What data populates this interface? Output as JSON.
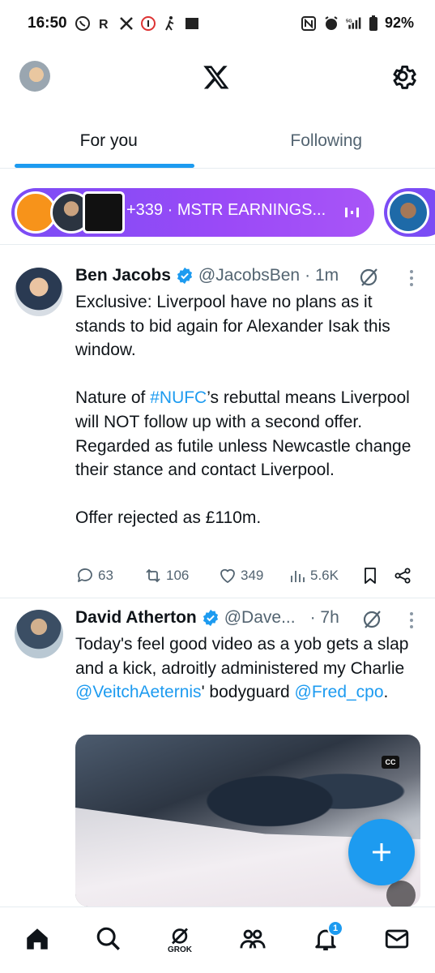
{
  "status_bar": {
    "time": "16:50",
    "battery": "92%",
    "network": "5G",
    "left_icons": [
      "whatsapp-icon",
      "r-icon",
      "x-icon",
      "counter-icon",
      "walk-icon",
      "app-icon"
    ],
    "right_icons": [
      "nfc-icon",
      "alarm-icon",
      "signal-icon",
      "battery-icon"
    ]
  },
  "header": {
    "logo": "x-logo-icon",
    "settings_icon": "gear-icon"
  },
  "tabs": {
    "for_you": "For you",
    "following": "Following",
    "active": "for_you"
  },
  "spaces": {
    "label": "+339 · MSTR EARNINGS...",
    "accent": "#8b4cf6"
  },
  "posts": [
    {
      "name": "Ben Jacobs",
      "handle": "@JacobsBen",
      "time": "· 1m",
      "verified": true,
      "text": "Exclusive: Liverpool have no plans as it stands to bid again for Alexander Isak this window.",
      "text2_pre": "Nature of ",
      "hashtag": "#NUFC",
      "text2_post": "’s rebuttal means Liverpool will NOT follow up with a second offer. Regarded as futile unless Newcastle change their stance and contact Liverpool.",
      "text3": "Offer rejected as £110m.",
      "replies": "63",
      "reposts": "106",
      "likes": "349",
      "views": "5.6K"
    },
    {
      "name": "David Atherton",
      "handle": "@Dave...",
      "time": "· 7h",
      "verified": true,
      "text_pre": "Today's feel good video as a yob gets a slap and a kick, adroitly administered my Charlie ",
      "mention1": "@VeitchAeternis",
      "text_mid": "' bodyguard ",
      "mention2": "@Fred_cpo",
      "text_post": ".",
      "media_badge": "CC"
    }
  ],
  "fab_label": "+",
  "bottom_nav": {
    "grok_label": "GROK",
    "notification_count": "1",
    "items": [
      "home-icon",
      "search-icon",
      "grok-icon",
      "communities-icon",
      "notifications-icon",
      "messages-icon"
    ]
  },
  "colors": {
    "brand": "#1d9bf0",
    "text": "#0f1419",
    "secondary": "#536471"
  }
}
